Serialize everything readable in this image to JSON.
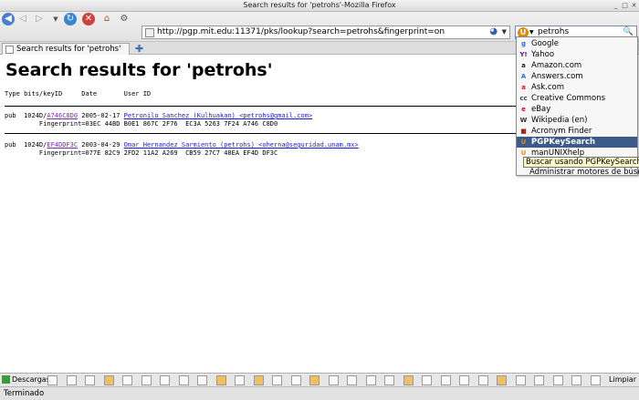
{
  "window": {
    "title": "Search results for 'petrohs'-Mozilla Firefox"
  },
  "toolbar": {
    "url": "http://pgp.mit.edu:11371/pks/lookup?search=petrohs&fingerprint=on",
    "search_text": "petrohs"
  },
  "tabs": [
    {
      "label": "Search results for 'petrohs'"
    }
  ],
  "page": {
    "heading": "Search results for 'petrohs'",
    "columns_header": "Type bits/keyID     Date       User ID",
    "results": [
      {
        "type_bits": "pub  1024D/",
        "keyid": "A746C8D0",
        "date": " 2005-02-17 ",
        "userid": "Petronilo Sanchez (Kulhuakan) <petrohs@gmail.com>",
        "fingerprint": "         Fingerprint=03EC 44BD B0E1 867C 2F76  EC3A 5263 7F24 A746 C8D0"
      },
      {
        "type_bits": "pub  1024D/",
        "keyid": "EF4DDF3C",
        "date": " 2003-04-29 ",
        "userid": "Omar Hernandez Sarmiento (petrohs) <oherna@seguridad.unam.mx>",
        "fingerprint": "         Fingerprint=077E 82C9 2FD2 11A2 A269  CB59 27C7 48EA EF4D DF3C"
      }
    ]
  },
  "search_engines": [
    {
      "label": "Google",
      "icon": "google-icon",
      "color": "#3366cc",
      "glyph": "g"
    },
    {
      "label": "Yahoo",
      "icon": "yahoo-icon",
      "color": "#7b0099",
      "glyph": "Y!"
    },
    {
      "label": "Amazon.com",
      "icon": "amazon-icon",
      "color": "#222222",
      "glyph": "a"
    },
    {
      "label": "Answers.com",
      "icon": "answers-icon",
      "color": "#2a6fd6",
      "glyph": "A"
    },
    {
      "label": "Ask.com",
      "icon": "ask-icon",
      "color": "#d02020",
      "glyph": "a"
    },
    {
      "label": "Creative Commons",
      "icon": "creative-commons-icon",
      "color": "#444444",
      "glyph": "cc"
    },
    {
      "label": "eBay",
      "icon": "ebay-icon",
      "color": "#c8102e",
      "glyph": "e"
    },
    {
      "label": "Wikipedia (en)",
      "icon": "wikipedia-icon",
      "color": "#333333",
      "glyph": "W"
    },
    {
      "label": "Acronym Finder",
      "icon": "acronym-finder-icon",
      "color": "#b02020",
      "glyph": "■"
    },
    {
      "label": "PGPKeySearch",
      "icon": "pgpkeysearch-icon",
      "color": "#e08a10",
      "glyph": "U",
      "selected": true
    },
    {
      "label": "manUNIXhelp",
      "icon": "manunixhelp-icon",
      "color": "#e08a10",
      "glyph": "U"
    }
  ],
  "dropdown_extra": "Administrar motores de búsque",
  "tooltip": "Buscar usando PGPKeySearch",
  "downloads": {
    "label": "Descargas",
    "clear_label": "Limpiar"
  },
  "status": {
    "text": "Terminado"
  }
}
